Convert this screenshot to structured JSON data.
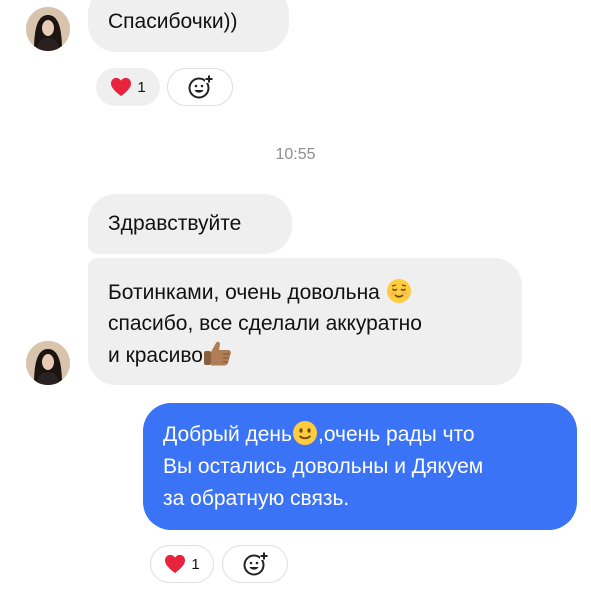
{
  "messages": [
    {
      "text": "Спасибочки))"
    },
    {
      "text": "Здравствуйте"
    },
    {
      "line1": "Ботинками, очень довольна",
      "line2": "спасибо, все сделали аккуратно",
      "line3": "и красиво"
    },
    {
      "line1_a": "Добрый день",
      "line1_b": ",очень рады что",
      "line2": "Вы остались довольны и Дякуем",
      "line3": "за обратную связь."
    }
  ],
  "timestamp": "10:55",
  "reactions": [
    {
      "emoji": "heart",
      "count": "1"
    },
    {
      "emoji": "heart",
      "count": "1"
    }
  ],
  "icons": [
    "avatar",
    "heart-icon",
    "add-reaction-icon",
    "relieved-face-emoji",
    "thumbs-up-emoji",
    "slightly-smiling-face-emoji"
  ],
  "colors": {
    "incoming_bubble": "#efefef",
    "outgoing_bubble": "#3a73f5",
    "timestamp": "#8e8e8e",
    "heart": "#e8233e"
  }
}
